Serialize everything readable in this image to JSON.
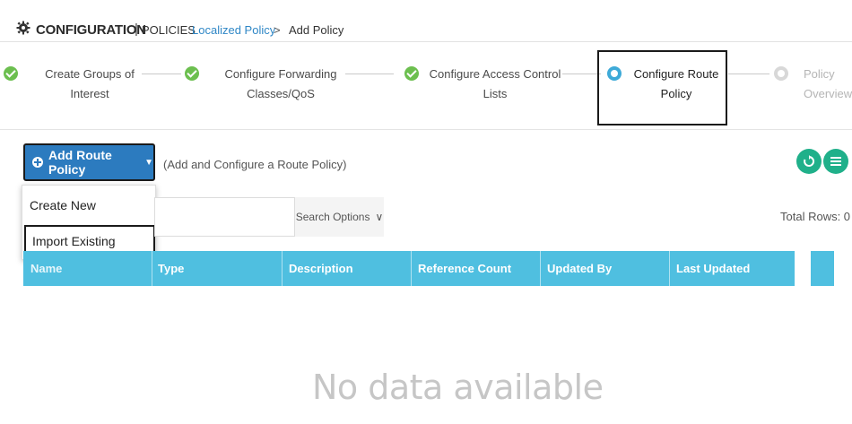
{
  "header": {
    "title_main": "CONFIGURATION",
    "title_sep": "|",
    "title_sub": "POLICIES",
    "breadcrumb_link": "Localized Policy",
    "breadcrumb_sep": ">",
    "breadcrumb_current": "Add Policy",
    "icon": "gear-icon"
  },
  "stepper": {
    "steps": [
      {
        "label": "Create Groups of\nInterest",
        "state": "done"
      },
      {
        "label": "Configure Forwarding\nClasses/QoS",
        "state": "done"
      },
      {
        "label": "Configure Access Control\nLists",
        "state": "done"
      },
      {
        "label": "Configure Route\nPolicy",
        "state": "active"
      },
      {
        "label": "Policy\nOverview",
        "state": "pending"
      }
    ]
  },
  "toolbar": {
    "add_button_label": "Add Route Policy",
    "hint": "(Add and Configure a Route Policy)",
    "dropdown": [
      "Create New",
      "Import Existing"
    ],
    "search_options_label": "Search Options",
    "total_rows": "Total Rows: 0"
  },
  "table": {
    "columns": [
      "Name",
      "Type",
      "Description",
      "Reference Count",
      "Updated By",
      "Last Updated"
    ],
    "empty_text": "No data available"
  },
  "colors": {
    "accent_blue": "#2c7bbf",
    "header_cyan": "#4fbfe0",
    "done_green": "#6cbf4f",
    "active_blue": "#3eaad8",
    "action_teal": "#20b08a"
  }
}
